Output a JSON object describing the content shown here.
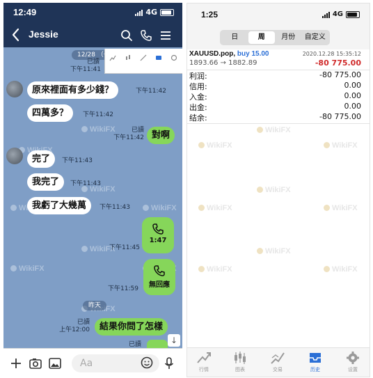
{
  "chat": {
    "status_time": "12:49",
    "status_net": "4G",
    "contact_name": "Jessie",
    "messages": [
      {
        "text": "原來裡面有多少錢？",
        "time": "下午11:42"
      },
      {
        "text": "四萬多？",
        "time": "下午11:42"
      },
      {
        "text": "對啊",
        "read": "已讀",
        "time": "下午11:42"
      },
      {
        "text": "完了",
        "time": "下午11:43"
      },
      {
        "text": "我完了",
        "time": "下午11:43"
      },
      {
        "text": "我虧了大幾萬",
        "time": "下午11:43"
      },
      {
        "call_label": "1:47",
        "time": "下午11:45"
      },
      {
        "call_label": "無回應",
        "time": "下午11:59"
      },
      {
        "text": "結果你問了怎樣",
        "read": "已讀",
        "time": "上午12:00"
      }
    ],
    "top_pill": "12/28 （一",
    "top_read": "已讀",
    "top_time": "下午11:41",
    "day_pill": "昨天",
    "last_read": "已讀",
    "input_placeholder": "Aa",
    "watermark": "WikiFX",
    "popup_icons": [
      "chart-icon",
      "candles-icon",
      "trade-icon",
      "history-icon",
      "settings-icon"
    ]
  },
  "history": {
    "status_time": "1:25",
    "status_net": "4G",
    "tabs": [
      {
        "label": "日",
        "active": false
      },
      {
        "label": "周",
        "active": true
      },
      {
        "label": "月份",
        "active": false
      },
      {
        "label": "自定义",
        "active": false
      }
    ],
    "deal": {
      "symbol": "XAUUSD.pop,",
      "action": "buy 15.00",
      "datetime": "2020.12.28 15:35:12",
      "prices": "1893.66 → 1882.89",
      "profit": "-80 775.00"
    },
    "summary": [
      {
        "label": "利润:",
        "value": "-80 775.00"
      },
      {
        "label": "信用:",
        "value": "0.00"
      },
      {
        "label": "入金:",
        "value": "0.00"
      },
      {
        "label": "出金:",
        "value": "0.00"
      },
      {
        "label": "结余:",
        "value": "-80 775.00"
      }
    ],
    "nav": [
      {
        "label": "行情",
        "icon": "chart-icon",
        "active": false
      },
      {
        "label": "图表",
        "icon": "candles-icon",
        "active": false
      },
      {
        "label": "交易",
        "icon": "trade-icon",
        "active": false
      },
      {
        "label": "历史",
        "icon": "history-icon",
        "active": true
      },
      {
        "label": "设置",
        "icon": "settings-icon",
        "active": false
      }
    ],
    "watermark": "WikiFX",
    "accent": "#2b6fd6",
    "loss_color": "#d02b2b"
  }
}
